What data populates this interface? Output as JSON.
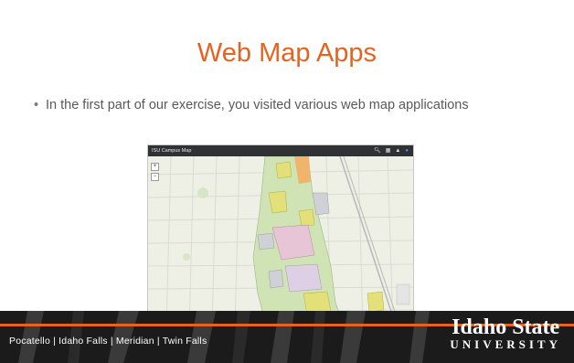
{
  "slide": {
    "title": "Web Map Apps",
    "bullet": "In the first part of our exercise, you visited various web map applications"
  },
  "map": {
    "header_title": "ISU Campus Map",
    "icons": [
      "search-icon",
      "grid-icon",
      "share-icon",
      "info-icon"
    ],
    "zoom_in": "+",
    "zoom_out": "−"
  },
  "footer": {
    "campuses": "Pocatello  |  Idaho Falls  |  Meridian  |  Twin Falls",
    "logo_line1": "Idaho State",
    "logo_line2": "UNIVERSITY"
  },
  "colors": {
    "accent": "#e8621f",
    "footer_bg": "#1b1b1b",
    "map_bg": "#eef0e6"
  }
}
